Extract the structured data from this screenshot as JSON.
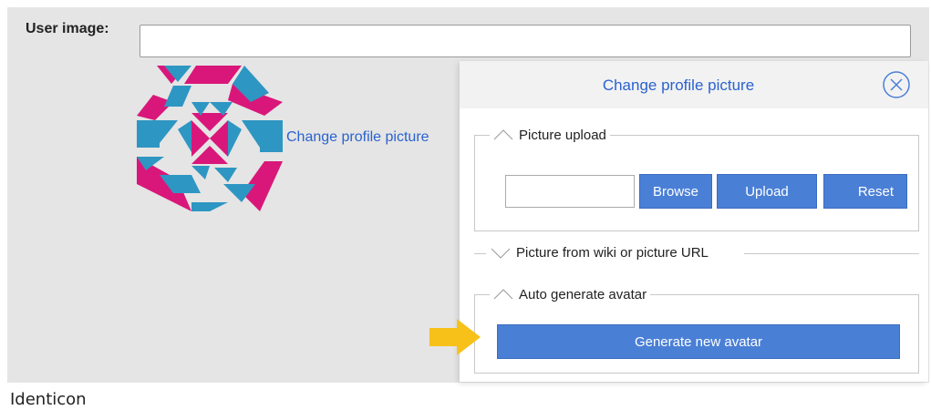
{
  "form": {
    "user_image_label": "User image:",
    "user_image_value": "",
    "change_profile_picture_link": "Change profile picture"
  },
  "dialog": {
    "title": "Change profile picture",
    "close_icon": "close-circle-icon",
    "sections": {
      "picture_upload": {
        "legend": "Picture upload",
        "state": "expanded",
        "file_value": "",
        "browse_label": "Browse",
        "upload_label": "Upload",
        "reset_label": "Reset"
      },
      "picture_from_wiki": {
        "legend": "Picture from wiki or picture URL",
        "state": "collapsed"
      },
      "auto_generate": {
        "legend": "Auto generate avatar",
        "state": "expanded",
        "generate_label": "Generate new avatar"
      }
    }
  },
  "caption": "Identicon",
  "colors": {
    "avatar_magenta": "#d9177a",
    "avatar_blue": "#2e96c2",
    "link_blue": "#2a63cf",
    "button_blue": "#4a7fd6",
    "arrow_yellow": "#f7c11a"
  }
}
